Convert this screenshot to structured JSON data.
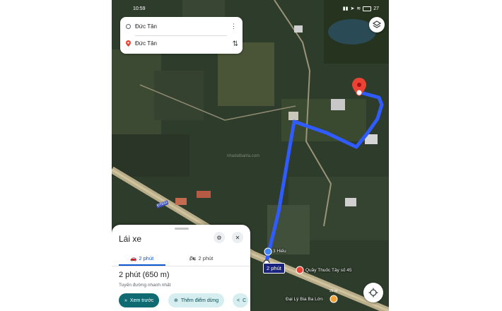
{
  "status_bar": {
    "time": "10:59",
    "battery": "27"
  },
  "search_card": {
    "origin": "Đức Tân",
    "destination": "Đức Tân"
  },
  "map": {
    "poi_hieu": "3 Hiếu",
    "poi_pharmacy": "Quầy Thuốc Tây số 45",
    "poi_beer": "Đại Lý Bia Ba Lớn",
    "road_label": "ĐT833",
    "watermark": "nhadatbanla.com",
    "route_time_badge": "2 phút",
    "scale_text": "25 m"
  },
  "sheet": {
    "title": "Lái xe",
    "tabs": [
      {
        "label": "2 phút",
        "icon": "car-icon",
        "selected": true
      },
      {
        "label": "2 phút",
        "icon": "motorbike-icon",
        "selected": false
      }
    ],
    "duration": "2 phút (650 m)",
    "route_note": "Tuyến đường nhanh nhất",
    "actions": {
      "preview": "Xem trước",
      "add_stop": "Thêm điểm dừng",
      "share": "C"
    }
  },
  "colors": {
    "route": "#2f5bff",
    "accent": "#0b57d0",
    "primary_button": "#0f6a72",
    "pin": "#ea4335"
  }
}
